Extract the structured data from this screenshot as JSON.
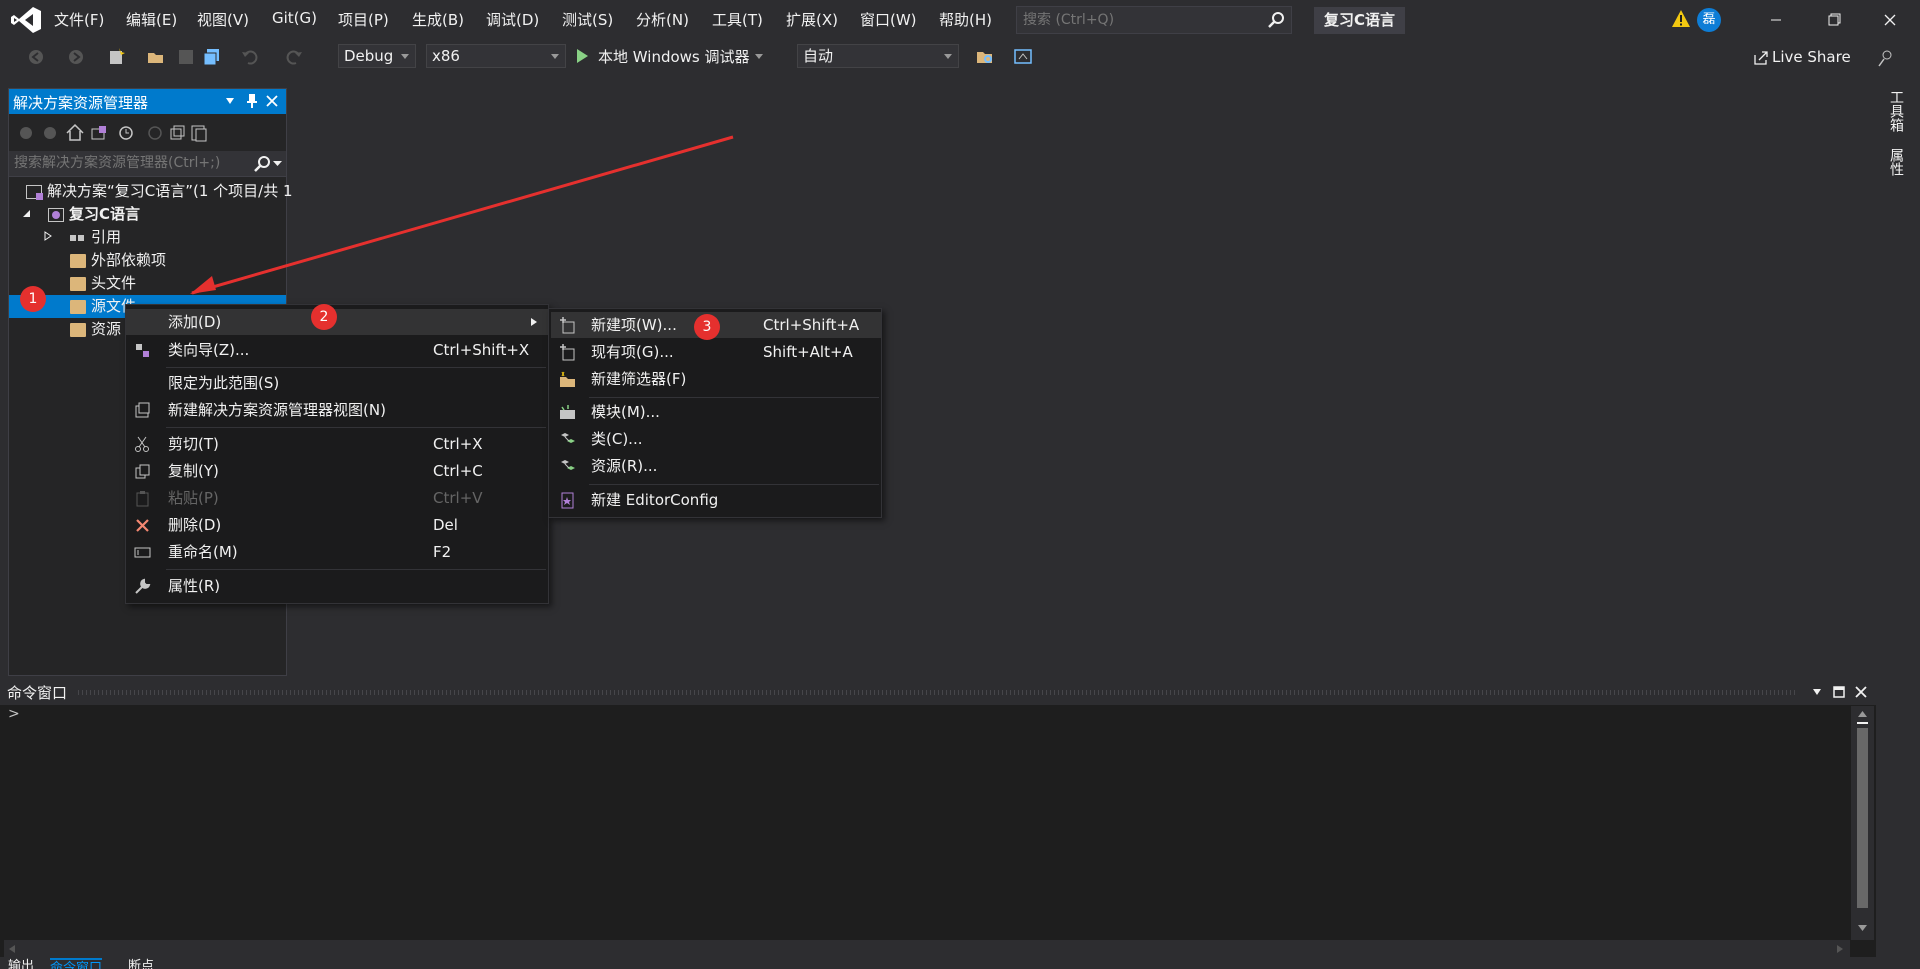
{
  "menubar": {
    "items": [
      "文件(F)",
      "编辑(E)",
      "视图(V)",
      "Git(G)",
      "项目(P)",
      "生成(B)",
      "调试(D)",
      "测试(S)",
      "分析(N)",
      "工具(T)",
      "扩展(X)",
      "窗口(W)",
      "帮助(H)"
    ],
    "search_placeholder": "搜索 (Ctrl+Q)",
    "project_name": "复习C语言",
    "avatar_initial": "磊"
  },
  "toolbar": {
    "config": "Debug",
    "platform": "x86",
    "debugger": "本地 Windows 调试器",
    "auto": "自动",
    "live_share": "Live Share"
  },
  "right_strip": {
    "tabs": [
      "工具箱",
      "属性"
    ]
  },
  "solution_explorer": {
    "title": "解决方案资源管理器",
    "search_placeholder": "搜索解决方案资源管理器(Ctrl+;)",
    "tree": {
      "solution": "解决方案“复习C语言”(1 个项目/共 1",
      "project": "复习C语言",
      "references": "引用",
      "external_deps": "外部依赖项",
      "header_files": "头文件",
      "source_files": "源文件",
      "resource_files": "资源"
    }
  },
  "context_menu": {
    "items": [
      {
        "label": "添加(D)",
        "shortcut": "",
        "submenu": true
      },
      {
        "label": "类向导(Z)...",
        "shortcut": "Ctrl+Shift+X"
      },
      {
        "label": "限定为此范围(S)",
        "shortcut": ""
      },
      {
        "label": "新建解决方案资源管理器视图(N)",
        "shortcut": ""
      },
      {
        "label": "剪切(T)",
        "shortcut": "Ctrl+X"
      },
      {
        "label": "复制(Y)",
        "shortcut": "Ctrl+C"
      },
      {
        "label": "粘贴(P)",
        "shortcut": "Ctrl+V",
        "disabled": true
      },
      {
        "label": "删除(D)",
        "shortcut": "Del"
      },
      {
        "label": "重命名(M)",
        "shortcut": "F2"
      },
      {
        "label": "属性(R)",
        "shortcut": ""
      }
    ]
  },
  "submenu": {
    "items": [
      {
        "label": "新建项(W)...",
        "shortcut": "Ctrl+Shift+A"
      },
      {
        "label": "现有项(G)...",
        "shortcut": "Shift+Alt+A"
      },
      {
        "label": "新建筛选器(F)",
        "shortcut": ""
      },
      {
        "label": "模块(M)...",
        "shortcut": ""
      },
      {
        "label": "类(C)...",
        "shortcut": ""
      },
      {
        "label": "资源(R)...",
        "shortcut": ""
      },
      {
        "label": "新建 EditorConfig",
        "shortcut": ""
      }
    ]
  },
  "annotations": {
    "step1": "1",
    "step2": "2",
    "step3": "3"
  },
  "command_window": {
    "title": "命令窗口",
    "prompt": ">",
    "tabs": [
      "输出",
      "命令窗口",
      "断点"
    ]
  },
  "colors": {
    "accent": "#007acc",
    "annotation_red": "#e5302e",
    "background": "#2d2d30"
  }
}
